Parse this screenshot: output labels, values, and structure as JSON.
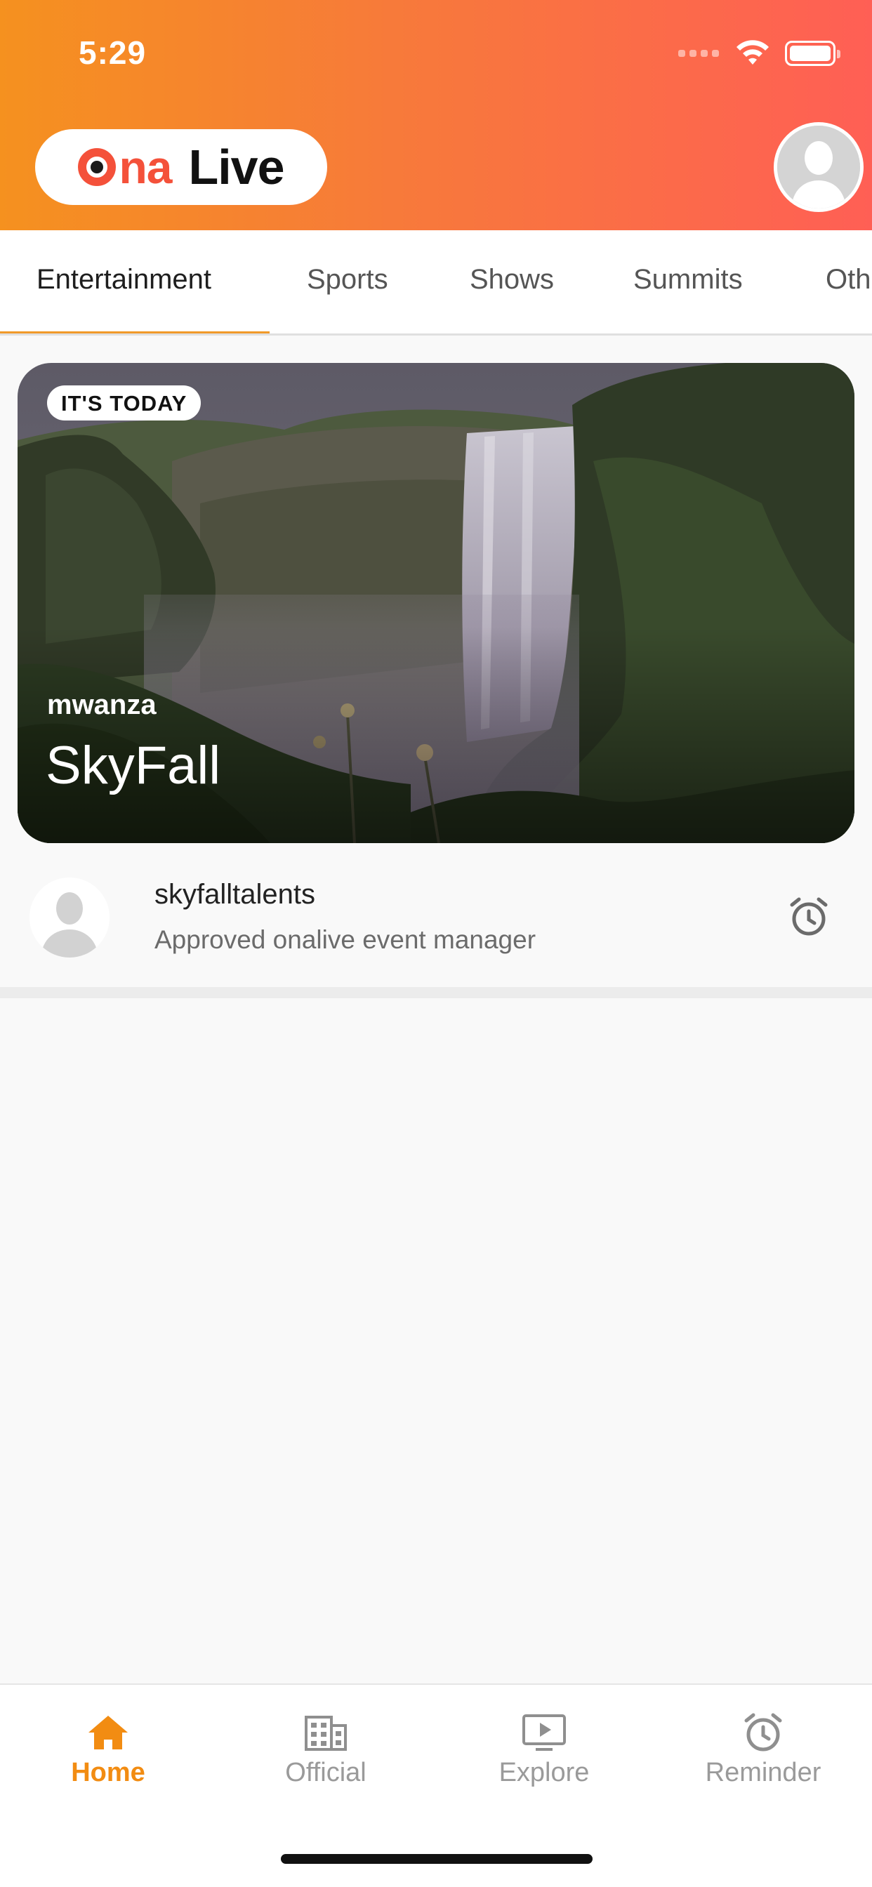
{
  "status_bar": {
    "time": "5:29"
  },
  "header": {
    "logo": {
      "brand_part1": "na",
      "brand_part2": "Live"
    },
    "profile_icon": "user-avatar-icon"
  },
  "tabs": [
    {
      "label": "Entertainment",
      "active": true
    },
    {
      "label": "Sports",
      "active": false
    },
    {
      "label": "Shows",
      "active": false
    },
    {
      "label": "Summits",
      "active": false
    },
    {
      "label": "Oth",
      "active": false
    }
  ],
  "event": {
    "badge": "IT'S TODAY",
    "location": "mwanza",
    "title": "SkyFall"
  },
  "organizer": {
    "name": "skyfalltalents",
    "subtitle": "Approved onalive event manager",
    "reminder_icon": "alarm-clock-icon"
  },
  "bottom_nav": [
    {
      "label": "Home",
      "icon": "home-icon",
      "active": true
    },
    {
      "label": "Official",
      "icon": "building-icon",
      "active": false
    },
    {
      "label": "Explore",
      "icon": "video-play-icon",
      "active": false
    },
    {
      "label": "Reminder",
      "icon": "alarm-clock-icon",
      "active": false
    }
  ],
  "colors": {
    "accent": "#f28c12",
    "header_gradient_start": "#f5911f",
    "header_gradient_end": "#ff5f55",
    "logo_red": "#f4513a"
  }
}
